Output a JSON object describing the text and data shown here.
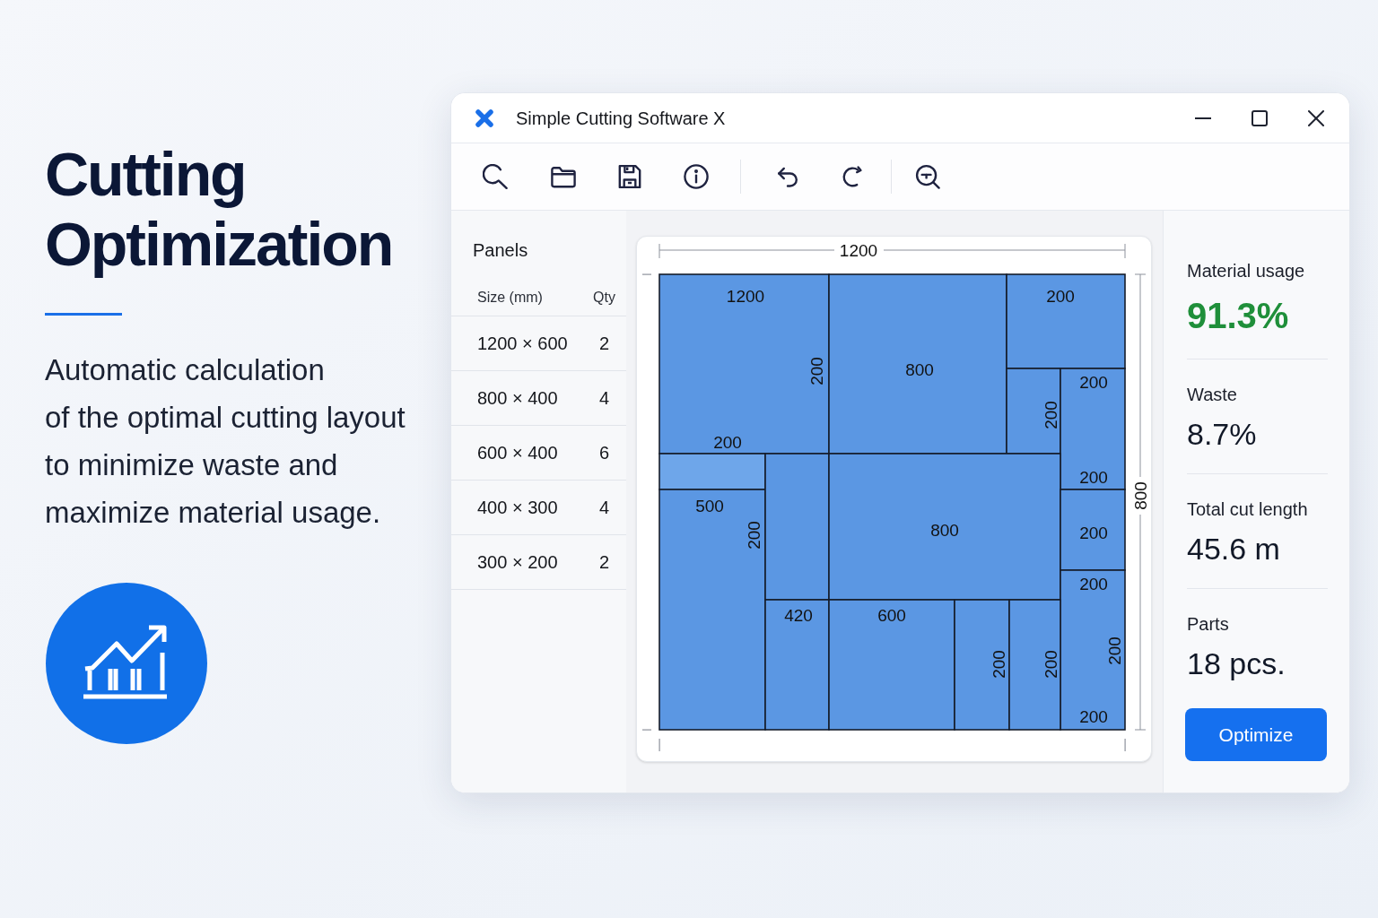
{
  "hero": {
    "title": "Cutting Optimization",
    "description_lines": [
      "Automatic calculation",
      "of the optimal cutting layout",
      "to minimize waste and",
      "maximize material usage."
    ]
  },
  "window": {
    "title": "Simple Cutting Software X"
  },
  "panels": {
    "title": "Panels",
    "columns": [
      "Size (mm)",
      "Qty"
    ],
    "rows": [
      {
        "size": "1200 × 600",
        "qty": "2"
      },
      {
        "size": "800 × 400",
        "qty": "4"
      },
      {
        "size": "600 × 400",
        "qty": "6"
      },
      {
        "size": "400 × 300",
        "qty": "4"
      },
      {
        "size": "300 × 200",
        "qty": "2"
      }
    ]
  },
  "layout": {
    "width_label": "1200",
    "height_label": "800",
    "pieces": [
      {
        "kind": "part",
        "labels": [
          {
            "text": "1200",
            "rotated": false
          },
          {
            "text": "200",
            "rotated": true
          },
          {
            "text": "200",
            "rotated": false
          }
        ]
      },
      {
        "kind": "part",
        "labels": [
          {
            "text": "800",
            "rotated": false
          }
        ]
      },
      {
        "kind": "part",
        "labels": [
          {
            "text": "200",
            "rotated": false
          }
        ]
      },
      {
        "kind": "part",
        "labels": [
          {
            "text": "200",
            "rotated": true
          }
        ]
      },
      {
        "kind": "part",
        "labels": [
          {
            "text": "200",
            "rotated": false
          },
          {
            "text": "200",
            "rotated": false
          }
        ]
      },
      {
        "kind": "offcut"
      },
      {
        "kind": "part",
        "labels": [
          {
            "text": "500",
            "rotated": false
          },
          {
            "text": "200",
            "rotated": true
          }
        ]
      },
      {
        "kind": "part"
      },
      {
        "kind": "part",
        "labels": [
          {
            "text": "800",
            "rotated": false
          }
        ]
      },
      {
        "kind": "part",
        "labels": [
          {
            "text": "200",
            "rotated": false
          }
        ]
      },
      {
        "kind": "part",
        "labels": [
          {
            "text": "200",
            "rotated": false
          },
          {
            "text": "200",
            "rotated": true
          },
          {
            "text": "200",
            "rotated": false
          }
        ]
      },
      {
        "kind": "part",
        "labels": [
          {
            "text": "420",
            "rotated": false
          }
        ]
      },
      {
        "kind": "part",
        "labels": [
          {
            "text": "600",
            "rotated": false
          }
        ]
      },
      {
        "kind": "part",
        "labels": [
          {
            "text": "200",
            "rotated": true
          }
        ]
      },
      {
        "kind": "part",
        "labels": [
          {
            "text": "200",
            "rotated": true
          }
        ]
      }
    ]
  },
  "stats": [
    {
      "label": "Material usage",
      "value": "91.3%",
      "highlighted": true
    },
    {
      "label": "Waste",
      "value": "8.7%",
      "highlighted": false
    },
    {
      "label": "Total cut length",
      "value": "45.6 m",
      "highlighted": false
    },
    {
      "label": "Parts",
      "value": "18 pcs.",
      "highlighted": false
    }
  ],
  "optimize_button": {
    "label": "Optimize"
  }
}
